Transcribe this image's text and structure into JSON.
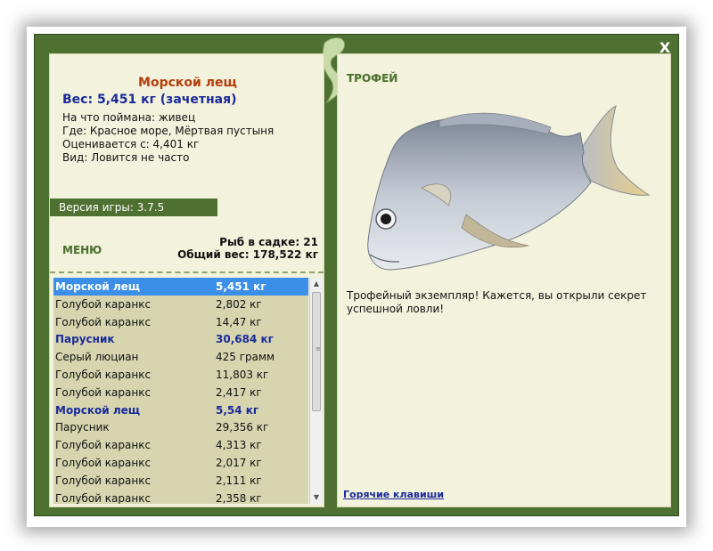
{
  "window": {
    "close_label": "X"
  },
  "fish": {
    "name": "Морской лещ",
    "weight": "Вес: 5,451 кг (зачетная)",
    "caught_on": "На что поймана: живец",
    "location": "Где: Красное море, Мёртвая пустыня",
    "price": "Оценивается с: 4,401 кг",
    "species": "Вид: Ловится не часто"
  },
  "version": "Версия игры: 3.7.5",
  "menu_label": "МЕНЮ",
  "stats": {
    "fish_in_cage": "Рыб в садке: 21",
    "total_weight": "Общий вес: 178,522 кг"
  },
  "catch_list": [
    {
      "name": "Морской лещ",
      "weight": "5,451 кг",
      "style": "sel"
    },
    {
      "name": "Голубой каранкс",
      "weight": "2,802 кг",
      "style": ""
    },
    {
      "name": "Голубой каранкс",
      "weight": "14,47 кг",
      "style": ""
    },
    {
      "name": "Парусник",
      "weight": "30,684 кг",
      "style": "bold"
    },
    {
      "name": "Серый люциан",
      "weight": "425 грамм",
      "style": ""
    },
    {
      "name": "Голубой каранкс",
      "weight": "11,803 кг",
      "style": ""
    },
    {
      "name": "Голубой каранкс",
      "weight": "2,417 кг",
      "style": ""
    },
    {
      "name": "Морской лещ",
      "weight": "5,54 кг",
      "style": "bold"
    },
    {
      "name": "Парусник",
      "weight": "29,356 кг",
      "style": ""
    },
    {
      "name": "Голубой каранкс",
      "weight": "4,313 кг",
      "style": ""
    },
    {
      "name": "Голубой каранкс",
      "weight": "2,017 кг",
      "style": ""
    },
    {
      "name": "Голубой каранкс",
      "weight": "2,111 кг",
      "style": ""
    },
    {
      "name": "Голубой каранкс",
      "weight": "2,358 кг",
      "style": ""
    }
  ],
  "trophy": {
    "title": "ТРОФЕЙ",
    "description": "Трофейный экземпляр! Кажется, вы открыли секрет успешной ловли!"
  },
  "hotkeys_label": "Горячие клавиши",
  "colors": {
    "frame": "#4e7132",
    "panel": "#f3f2dc",
    "list_bg": "#d6d5af",
    "selection": "#3b8fe8",
    "fish_name": "#b53d0c",
    "highlight_text": "#1a2a9a"
  }
}
